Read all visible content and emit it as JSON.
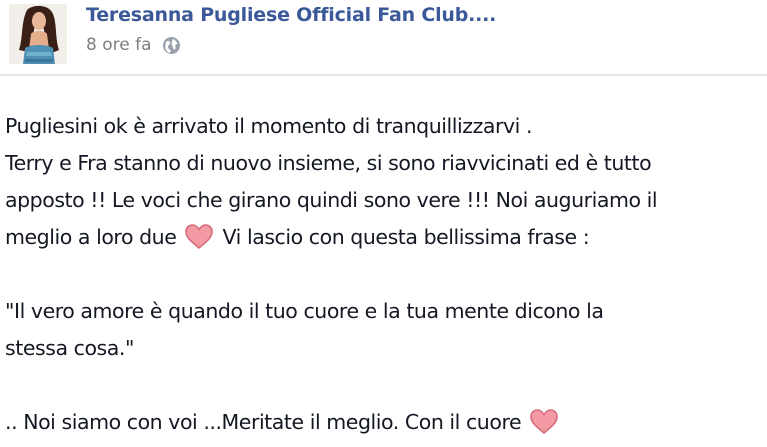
{
  "post": {
    "author": "Teresanna Pugliese Official Fan Club....",
    "timestamp": "8 ore fa",
    "privacy_icon": "globe-icon",
    "body": {
      "p1_line1": "Pugliesini ok è arrivato il momento di tranquillizzarvi .",
      "p1_line2": "Terry e Fra stanno di nuovo insieme, si sono riavvicinati ed è tutto",
      "p1_line3": "apposto !! Le voci che girano quindi sono vere !!! Noi auguriamo il",
      "p1_line4_before": "meglio a loro due",
      "p1_line4_after": "Vi lascio con questa bellissima frase :",
      "quote_line1": "\"Il vero amore è quando il tuo cuore e la tua mente dicono la",
      "quote_line2": "stessa cosa.\"",
      "closing": ".. Noi siamo con voi ...Meritate il meglio. Con il cuore",
      "emoji_icon": "heart-icon"
    }
  },
  "colors": {
    "author_link": "#3b5998",
    "meta_text": "#7f7f7f",
    "body_text": "#141823",
    "heart_fill": "#f39aa5",
    "heart_stroke": "#d66b7a"
  }
}
